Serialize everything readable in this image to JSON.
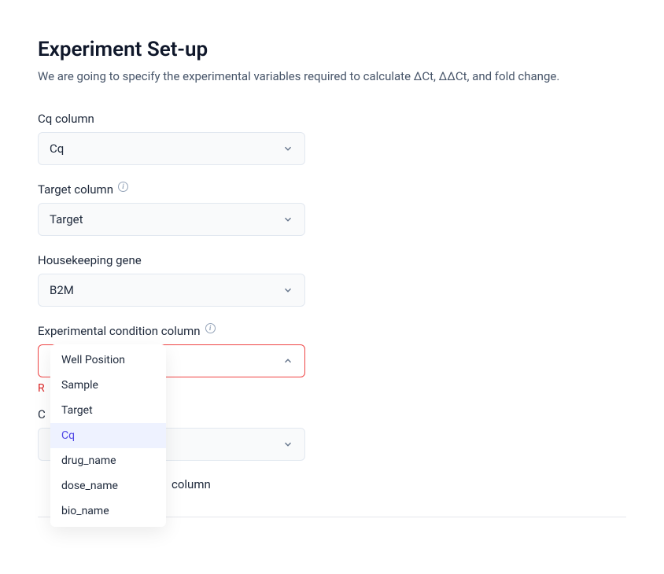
{
  "title": "Experiment Set-up",
  "subtitle": "We are going to specify the experimental variables required to calculate ΔCt, ΔΔCt, and fold change.",
  "fields": {
    "cq": {
      "label": "Cq column",
      "value": "Cq"
    },
    "target": {
      "label": "Target column",
      "value": "Target"
    },
    "housekeeping": {
      "label": "Housekeeping gene",
      "value": "B2M"
    },
    "experimental": {
      "label": "Experimental condition column",
      "value": ""
    }
  },
  "error_partial": "R",
  "glimpse_label_c": "C",
  "partial_after_dropdown": " column",
  "dropdown": {
    "options": [
      "Well Position",
      "Sample",
      "Target",
      "Cq",
      "drug_name",
      "dose_name",
      "bio_name"
    ],
    "highlighted_index": 3
  }
}
